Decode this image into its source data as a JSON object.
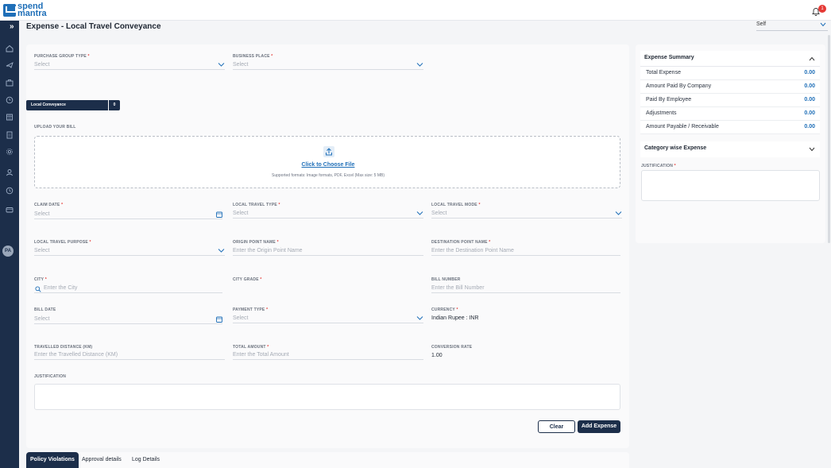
{
  "app": {
    "logo_line1": "spend",
    "logo_line2": "mantra",
    "notification_count": "1"
  },
  "header": {
    "title": "Expense - Local Travel Conveyance",
    "self_select_value": "Self"
  },
  "tab_pill": {
    "label": "Local Conveyance",
    "count": "0"
  },
  "fields": {
    "purchase_group_type": {
      "label": "PURCHASE GROUP TYPE",
      "placeholder": "Select"
    },
    "business_place": {
      "label": "BUSINESS PLACE",
      "placeholder": "Select"
    },
    "upload_label": "UPLOAD YOUR BILL",
    "upload_link": "Click to Choose File",
    "upload_hint": "Supported formats: Image formats, PDF, Excel (Max size: 5 MB)",
    "claim_date": {
      "label": "CLAIM DATE",
      "placeholder": "Select"
    },
    "local_travel_type": {
      "label": "LOCAL TRAVEL TYPE",
      "placeholder": "Select"
    },
    "local_travel_mode": {
      "label": "LOCAL TRAVEL MODE",
      "placeholder": "Select"
    },
    "local_travel_purpose": {
      "label": "LOCAL TRAVEL PURPOSE",
      "placeholder": "Select"
    },
    "origin_point_name": {
      "label": "ORIGIN POINT NAME",
      "placeholder": "Enter the Origin Point Name"
    },
    "destination_point_name": {
      "label": "DESTINATION POINT NAME",
      "placeholder": "Enter the Destination Point Name"
    },
    "city": {
      "label": "CITY",
      "placeholder": "Enter the City"
    },
    "city_grade": {
      "label": "CITY GRADE"
    },
    "bill_number": {
      "label": "BILL NUMBER",
      "placeholder": "Enter the Bill Number"
    },
    "bill_date": {
      "label": "BILL DATE",
      "placeholder": "Select"
    },
    "payment_type": {
      "label": "PAYMENT TYPE",
      "placeholder": "Select"
    },
    "currency": {
      "label": "CURRENCY",
      "value": "Indian Rupee : INR"
    },
    "travelled_distance": {
      "label": "TRAVELLED DISTANCE (KM)",
      "placeholder": "Enter the Travelled Distance (KM)"
    },
    "total_amount": {
      "label": "TOTAL AMOUNT",
      "placeholder": "Enter the Total Amount"
    },
    "conversion_rate": {
      "label": "CONVERSION RATE",
      "value": "1.00"
    },
    "justification": {
      "label": "JUSTIFICATION"
    }
  },
  "buttons": {
    "clear": "Clear",
    "add_expense": "Add Expense"
  },
  "bottom_tabs": [
    "Policy Violations",
    "Approval details",
    "Log Details"
  ],
  "summary": {
    "title": "Expense Summary",
    "rows": [
      {
        "label": "Total Expense",
        "value": "0.00"
      },
      {
        "label": "Amount Paid By Company",
        "value": "0.00"
      },
      {
        "label": "Paid By Employee",
        "value": "0.00"
      },
      {
        "label": "Adjustments",
        "value": "0.00"
      },
      {
        "label": "Amount Payable / Receivable",
        "value": "0.00"
      }
    ],
    "category_title": "Category wise Expense",
    "justification_label": "JUSTIFICATION"
  },
  "user": {
    "initials": "PA"
  },
  "colors": {
    "navy": "#1c2e4a",
    "accent": "#1f6fb8",
    "required": "#e53935"
  }
}
